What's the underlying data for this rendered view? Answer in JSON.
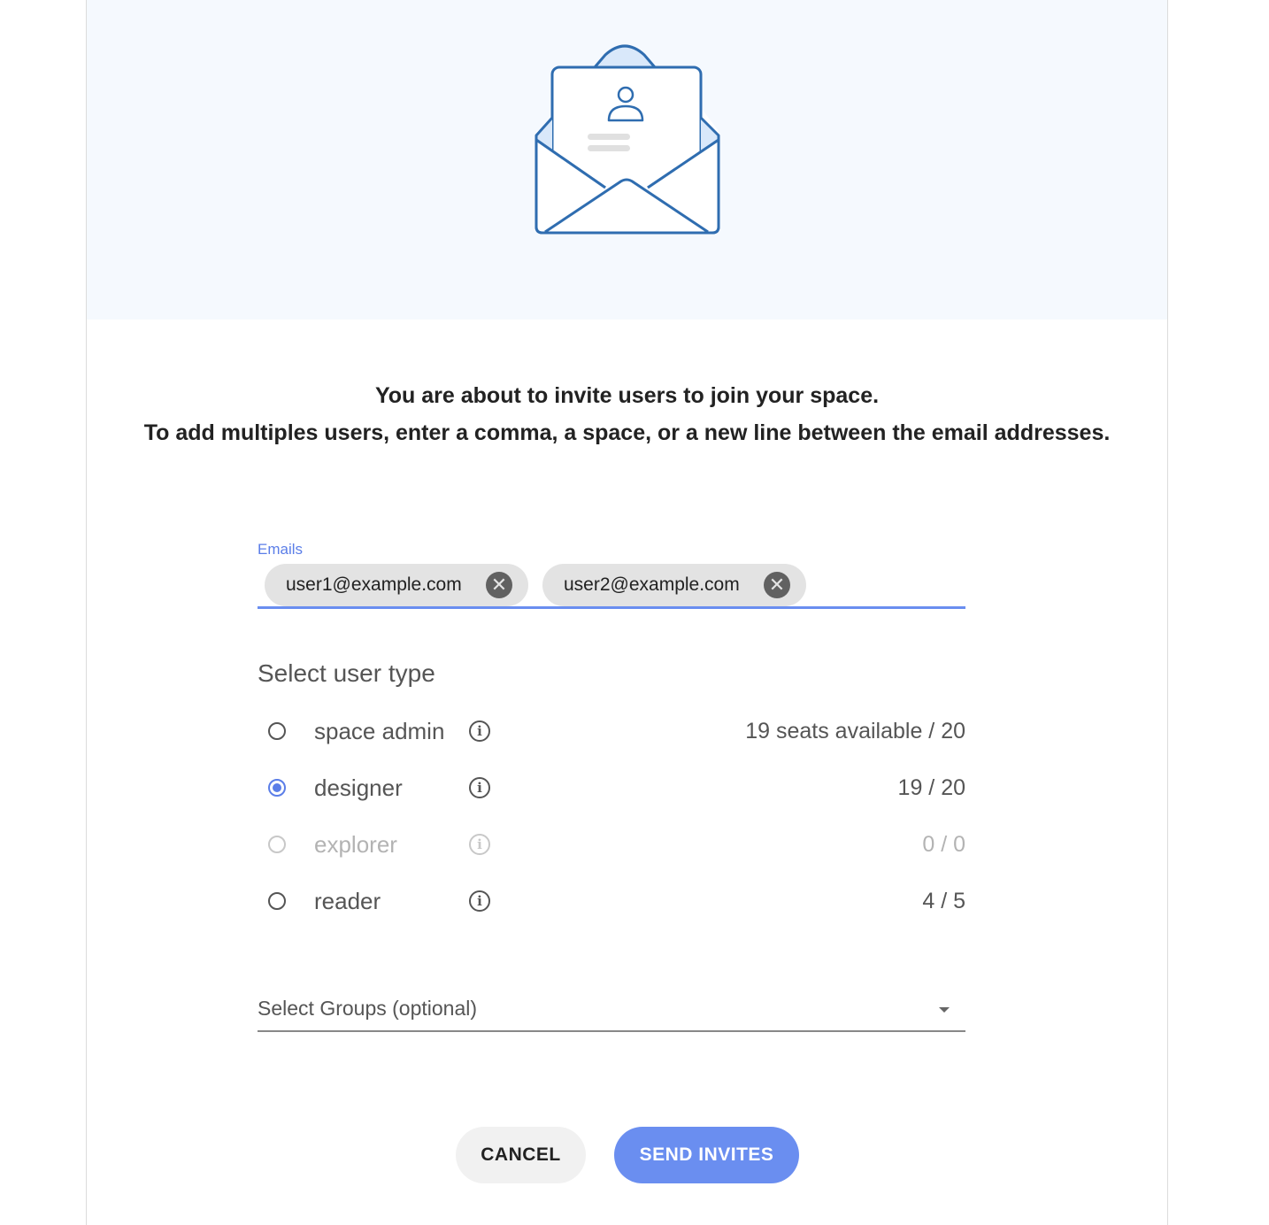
{
  "intro": {
    "line1": "You are about to invite users to join your space.",
    "line2": "To add multiples users, enter a comma, a space, or a new line between the email addresses."
  },
  "emails": {
    "label": "Emails",
    "chips": [
      "user1@example.com",
      "user2@example.com"
    ],
    "remove_glyph": "✕"
  },
  "user_type": {
    "title": "Select user type",
    "options": [
      {
        "label": "space admin",
        "seats": "19 seats available / 20",
        "selected": false,
        "disabled": false
      },
      {
        "label": "designer",
        "seats": "19 / 20",
        "selected": true,
        "disabled": false
      },
      {
        "label": "explorer",
        "seats": "0 / 0",
        "selected": false,
        "disabled": true
      },
      {
        "label": "reader",
        "seats": "4 / 5",
        "selected": false,
        "disabled": false
      }
    ],
    "info_glyph": "i"
  },
  "groups": {
    "placeholder": "Select Groups (optional)"
  },
  "actions": {
    "cancel": "CANCEL",
    "send": "SEND INVITES"
  },
  "colors": {
    "accent": "#6a8ef0",
    "hero_bg": "#f5f9fe",
    "icon_stroke": "#2f6db0"
  },
  "icons": {
    "hero": "envelope-invite-icon",
    "remove": "close-circle-icon",
    "info": "info-icon",
    "dropdown": "caret-down-icon"
  }
}
